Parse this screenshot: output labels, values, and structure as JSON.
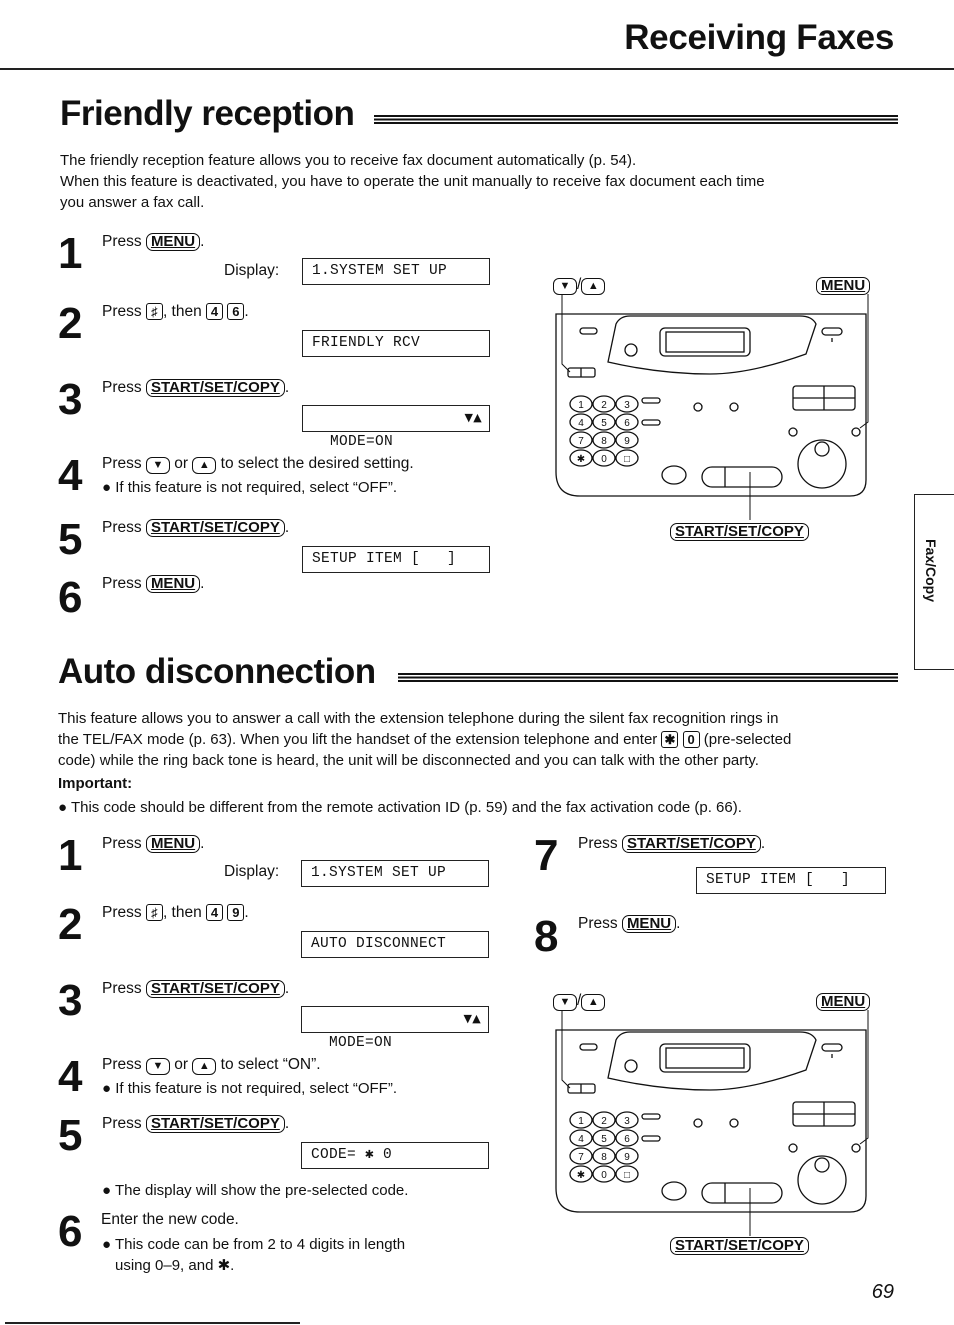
{
  "header": {
    "title": "Receiving Faxes"
  },
  "side_tab": {
    "label": "Fax/Copy"
  },
  "page_number": "69",
  "friendly": {
    "title": "Friendly reception",
    "intro": [
      "The friendly reception feature allows you to receive fax document automatically (p. 54).",
      "When this feature is deactivated, you have to operate the unit manually to receive fax document each time",
      "you answer a fax call."
    ],
    "steps": [
      {
        "num": "1",
        "press": "Press",
        "key": "MENU",
        "after": ".",
        "display_label": "Display:",
        "lcd": "1.SYSTEM SET UP"
      },
      {
        "num": "2",
        "press": "Press",
        "key1": "♯",
        "mid": ", then",
        "key2": "4",
        "key3": "6",
        "after": ".",
        "lcd": "FRIENDLY RCV"
      },
      {
        "num": "3",
        "press": "Press",
        "key": "START/SET/COPY",
        "after": ".",
        "lcd": "MODE=ON",
        "lcd_arrows": "▼▲"
      },
      {
        "num": "4",
        "press": "Press",
        "key_down": "▼",
        "or": "or",
        "key_up": "▲",
        "text": "to select the desired setting.",
        "bullet": "● If this feature is not required, select “OFF”."
      },
      {
        "num": "5",
        "press": "Press",
        "key": "START/SET/COPY",
        "after": ".",
        "lcd": "SETUP ITEM [   ]"
      },
      {
        "num": "6",
        "press": "Press",
        "key": "MENU",
        "after": "."
      }
    ],
    "diagram": {
      "arrows_label": "/",
      "arrow_down": "▼",
      "arrow_up": "▲",
      "menu_label": "MENU",
      "start_label": "START/SET/COPY"
    }
  },
  "auto": {
    "title": "Auto disconnection",
    "intro": [
      "This feature allows you to answer a call with the extension telephone during the silent fax recognition rings in",
      "the TEL/FAX mode (p. 63). When you lift the handset of the extension telephone and enter",
      "(pre-selected",
      "code) while the ring back tone is heard, the unit will be disconnected and you can talk with the other party."
    ],
    "intro_keys": [
      "✱",
      "0"
    ],
    "important_label": "Important:",
    "important_bullet": "● This code should be different from the remote activation ID (p. 59) and the fax activation code (p. 66).",
    "steps": [
      {
        "num": "1",
        "press": "Press",
        "key": "MENU",
        "after": ".",
        "display_label": "Display:",
        "lcd": "1.SYSTEM SET UP"
      },
      {
        "num": "2",
        "press": "Press",
        "key1": "♯",
        "mid": ", then",
        "key2": "4",
        "key3": "9",
        "after": ".",
        "lcd": "AUTO DISCONNECT"
      },
      {
        "num": "3",
        "press": "Press",
        "key": "START/SET/COPY",
        "after": ".",
        "lcd": "MODE=ON",
        "lcd_arrows": "▼▲"
      },
      {
        "num": "4",
        "press": "Press",
        "key_down": "▼",
        "or": "or",
        "key_up": "▲",
        "text": "to select “ON”.",
        "bullet": "● If this feature is not required, select “OFF”."
      },
      {
        "num": "5",
        "press": "Press",
        "key": "START/SET/COPY",
        "after": ".",
        "lcd": "CODE= ✱ 0",
        "bullet": "● The display will show the pre-selected code."
      },
      {
        "num": "6",
        "text": "Enter the new code.",
        "bullet1": "● This code can be from 2 to 4 digits in length",
        "bullet2": "using 0–9, and ✱."
      },
      {
        "num": "7",
        "press": "Press",
        "key": "START/SET/COPY",
        "after": ".",
        "lcd": "SETUP ITEM [   ]"
      },
      {
        "num": "8",
        "press": "Press",
        "key": "MENU",
        "after": "."
      }
    ],
    "diagram": {
      "arrows_label": "/",
      "arrow_down": "▼",
      "arrow_up": "▲",
      "menu_label": "MENU",
      "start_label": "START/SET/COPY"
    }
  },
  "keypad": {
    "keys": [
      "1",
      "2",
      "3",
      "4",
      "5",
      "6",
      "7",
      "8",
      "9",
      "✱",
      "0",
      "□"
    ]
  }
}
